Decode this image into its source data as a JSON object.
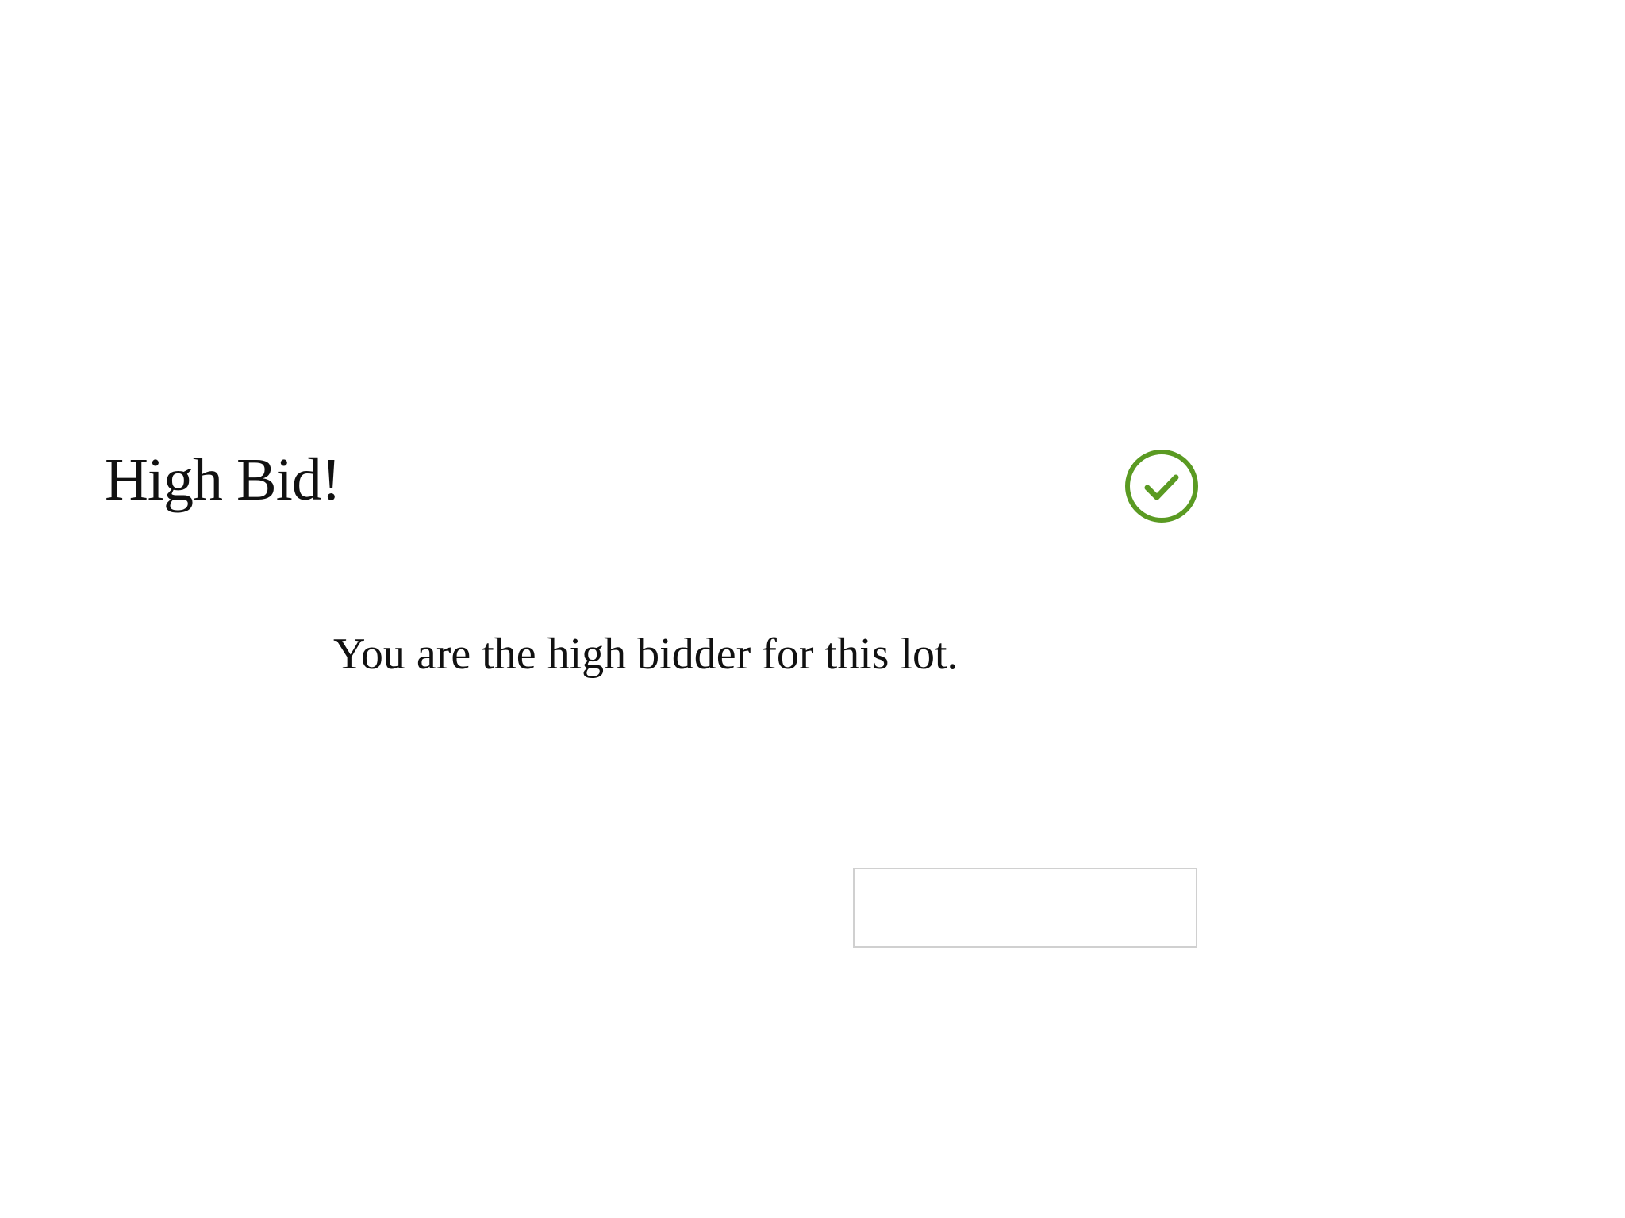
{
  "dialog": {
    "title": "High Bid!",
    "status_icon": "check-circle-icon",
    "message": "You are the high bidder for this lot.",
    "button_label": ""
  },
  "colors": {
    "success": "#5a9a22",
    "text": "#111111",
    "button_border": "#d0d0d0",
    "background": "#ffffff"
  }
}
